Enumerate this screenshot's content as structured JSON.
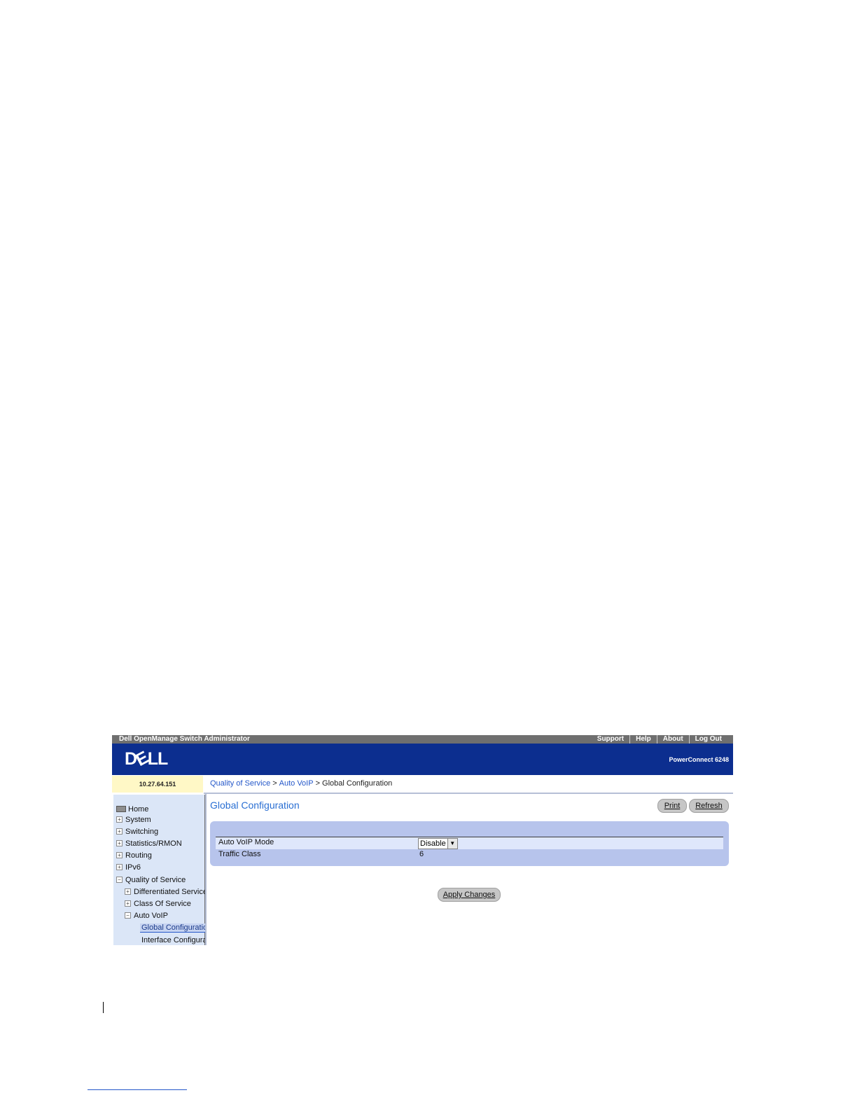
{
  "app": {
    "title": "Dell OpenManage Switch Administrator",
    "links": [
      "Support",
      "Help",
      "About",
      "Log Out"
    ],
    "logo": {
      "d": "D",
      "e": "E",
      "ll": "LL"
    },
    "product": "PowerConnect 6248",
    "ip": "10.27.64.151"
  },
  "breadcrumb": {
    "c1": "Quality of Service",
    "sep": ">",
    "c2": "Auto VoIP",
    "c3": "Global Configuration"
  },
  "sidebar": {
    "home": "Home",
    "items": [
      "System",
      "Switching",
      "Statistics/RMON",
      "Routing",
      "IPv6",
      "Quality of Service"
    ],
    "qos_children": [
      "Differentiated Services",
      "Class Of Service",
      "Auto VoIP"
    ],
    "voip_children": [
      "Global Configuration",
      "Interface Configuration"
    ],
    "toggle_collapsed": "+",
    "toggle_expanded": "−"
  },
  "main": {
    "title": "Global Configuration",
    "print_label": "Print",
    "refresh_label": "Refresh",
    "rows": [
      {
        "label": "Auto VoIP Mode",
        "value": "Disable"
      },
      {
        "label": "Traffic Class",
        "value": "6"
      }
    ],
    "apply_label": "Apply Changes"
  },
  "colors": {
    "banner": "#0c2e8f",
    "link": "#2457c9",
    "panel": "#b7c4ec",
    "sidebar": "#dbe6f7"
  }
}
